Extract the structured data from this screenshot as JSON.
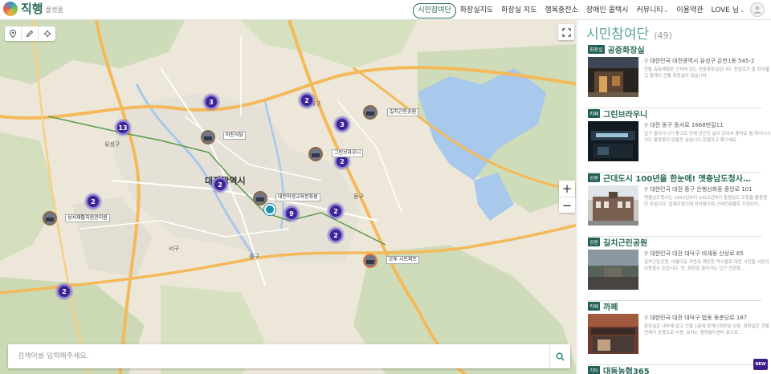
{
  "header": {
    "logo_text": "직행",
    "logo_sub": "플랫폼",
    "nav": [
      {
        "label": "시민참여단",
        "active": true
      },
      {
        "label": "화장실지도"
      },
      {
        "label": "화장실 지도"
      },
      {
        "label": "행복충전소"
      },
      {
        "label": "장애인 콜택시"
      },
      {
        "label": "커뮤니티",
        "dropdown": true
      },
      {
        "label": "이용약관"
      },
      {
        "label": "LOVE 님",
        "dropdown": true
      }
    ]
  },
  "map": {
    "city_label": "대전광역시",
    "place_labels": [
      "대덕구",
      "유성구",
      "서구",
      "동구",
      "중구"
    ],
    "clusters": [
      "3",
      "2",
      "13",
      "3",
      "2",
      "2",
      "2",
      "9",
      "2",
      "2",
      "2"
    ],
    "pins": [
      {
        "label": "길치근린공원"
      },
      {
        "label": "마진식당"
      },
      {
        "label": "그린브라우니"
      },
      {
        "label": "대전학생교육문화원"
      },
      {
        "label": "성서재활지원관리원"
      },
      {
        "label": "오투 시트피트"
      }
    ],
    "search_placeholder": "검색어를 입력해주세요.",
    "zoom_in": "+",
    "zoom_out": "−"
  },
  "panel": {
    "title": "시민참여단",
    "count": "(49)",
    "cards": [
      {
        "badge": "화장실",
        "name": "공중화장실",
        "address": "대한민국 대전광역시 유성구 온천1동 545-2",
        "desc": "한밭 축축체험장 근처에 있는 공중화장실입니다. 진입로가 잘 되어있고 함께이 간통 화장실이 있습니다."
      },
      {
        "badge": "카페",
        "name": "그린브라우니",
        "address": "대전 동구 동서로 1668번길11",
        "desc": "입구 들어가시기 좋고요 안에 공간은 넓이 있어서 좋아요 휠 하다나시지도 불편함이 없을듯 싶습니다 친절하고 좋으세요"
      },
      {
        "badge": "공원",
        "name": "근대도시 100년을 한눈에! 옛충남도청사를…",
        "address": "대한민국 대전 중구 은행선화동 중앙로 101",
        "desc": "옛충남도청사는 1932년부터 2012년까지 충청남도 도청을 활용했던 곳입니다. 일제강점기에 지어졌으며 근대건축물로 지정되어…"
      },
      {
        "badge": "공원",
        "name": "길치근린공원",
        "address": "대한민국 대전 대덕구 비래동 산상로 65",
        "desc": "길치근린공원, 아름다운 자연과 깨끗한 먹수물로 대전 시민들 시민이 이용할수 있습니다. 단, 화장실 들어가는 입구 전관할…"
      },
      {
        "badge": "카페",
        "name": "까페",
        "address": "대한민국 대전 대덕구 법동 동춘당로 187",
        "desc": "화장실은 내부에 없고 건물 1층에 장애인화장실 있음. 화장실은 건물 전체가 공용으로 사용, 보다는 행정복지센터 앞으로…"
      },
      {
        "badge": "기타",
        "name": "대동농협365",
        "address": "",
        "desc": ""
      }
    ],
    "new_badge": "NEW"
  },
  "colors": {
    "accent": "#2a6a5a",
    "title": "#5ca59a",
    "cluster": "#3d2596"
  }
}
